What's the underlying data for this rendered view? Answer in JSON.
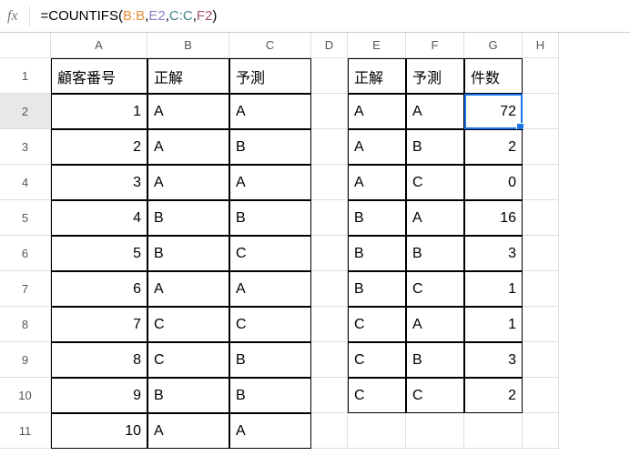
{
  "formula": {
    "prefix": "=COUNTIFS(",
    "arg1": "B:B",
    "arg2": "E2",
    "arg3": "C:C",
    "arg4": "F2",
    "suffix": ")"
  },
  "columns": [
    "A",
    "B",
    "C",
    "D",
    "E",
    "F",
    "G",
    "H"
  ],
  "row_numbers": [
    "1",
    "2",
    "3",
    "4",
    "5",
    "6",
    "7",
    "8",
    "9",
    "10",
    "11"
  ],
  "headers_left": {
    "A": "顧客番号",
    "B": "正解",
    "C": "予測"
  },
  "headers_right": {
    "E": "正解",
    "F": "予測",
    "G": "件数"
  },
  "left_table": [
    {
      "id": "1",
      "B": "A",
      "C": "A"
    },
    {
      "id": "2",
      "B": "A",
      "C": "B"
    },
    {
      "id": "3",
      "B": "A",
      "C": "A"
    },
    {
      "id": "4",
      "B": "B",
      "C": "B"
    },
    {
      "id": "5",
      "B": "B",
      "C": "C"
    },
    {
      "id": "6",
      "B": "A",
      "C": "A"
    },
    {
      "id": "7",
      "B": "C",
      "C": "C"
    },
    {
      "id": "8",
      "B": "C",
      "C": "B"
    },
    {
      "id": "9",
      "B": "B",
      "C": "B"
    },
    {
      "id": "10",
      "B": "A",
      "C": "A"
    }
  ],
  "right_table": [
    {
      "E": "A",
      "F": "A",
      "G": "72"
    },
    {
      "E": "A",
      "F": "B",
      "G": "2"
    },
    {
      "E": "A",
      "F": "C",
      "G": "0"
    },
    {
      "E": "B",
      "F": "A",
      "G": "16"
    },
    {
      "E": "B",
      "F": "B",
      "G": "3"
    },
    {
      "E": "B",
      "F": "C",
      "G": "1"
    },
    {
      "E": "C",
      "F": "A",
      "G": "1"
    },
    {
      "E": "C",
      "F": "B",
      "G": "3"
    },
    {
      "E": "C",
      "F": "C",
      "G": "2"
    }
  ],
  "chart_data": {
    "type": "table",
    "title": "COUNTIFS confusion matrix counts",
    "left_table": {
      "columns": [
        "顧客番号",
        "正解",
        "予測"
      ],
      "rows": [
        [
          1,
          "A",
          "A"
        ],
        [
          2,
          "A",
          "B"
        ],
        [
          3,
          "A",
          "A"
        ],
        [
          4,
          "B",
          "B"
        ],
        [
          5,
          "B",
          "C"
        ],
        [
          6,
          "A",
          "A"
        ],
        [
          7,
          "C",
          "C"
        ],
        [
          8,
          "C",
          "B"
        ],
        [
          9,
          "B",
          "B"
        ],
        [
          10,
          "A",
          "A"
        ]
      ]
    },
    "right_table": {
      "columns": [
        "正解",
        "予測",
        "件数"
      ],
      "rows": [
        [
          "A",
          "A",
          72
        ],
        [
          "A",
          "B",
          2
        ],
        [
          "A",
          "C",
          0
        ],
        [
          "B",
          "A",
          16
        ],
        [
          "B",
          "B",
          3
        ],
        [
          "B",
          "C",
          1
        ],
        [
          "C",
          "A",
          1
        ],
        [
          "C",
          "B",
          3
        ],
        [
          "C",
          "C",
          2
        ]
      ]
    }
  }
}
